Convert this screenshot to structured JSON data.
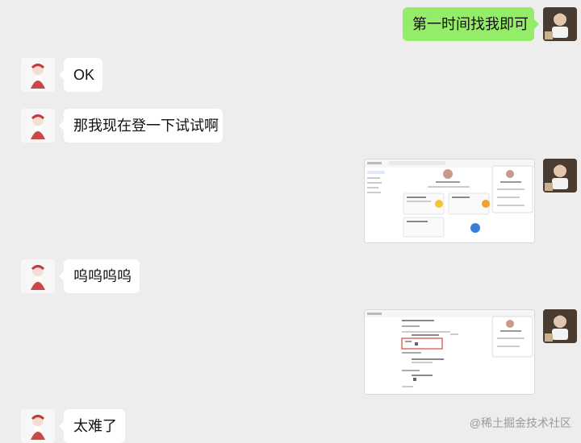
{
  "messages": [
    {
      "side": "out",
      "type": "text",
      "text": "第一时间找我即可"
    },
    {
      "side": "in",
      "type": "text",
      "text": "OK"
    },
    {
      "side": "in",
      "type": "text",
      "text": "那我现在登一下试试啊"
    },
    {
      "side": "out",
      "type": "image",
      "icon": "screenshot-profile-page"
    },
    {
      "side": "in",
      "type": "text",
      "text": "呜呜呜呜"
    },
    {
      "side": "out",
      "type": "image",
      "icon": "screenshot-settings-page"
    },
    {
      "side": "in",
      "type": "text",
      "text": "太难了"
    }
  ],
  "watermark": "@稀土掘金技术社区",
  "colors": {
    "background": "#ededed",
    "outgoing_bubble": "#95ec69",
    "incoming_bubble": "#ffffff",
    "highlight_box": "#e0423c"
  }
}
